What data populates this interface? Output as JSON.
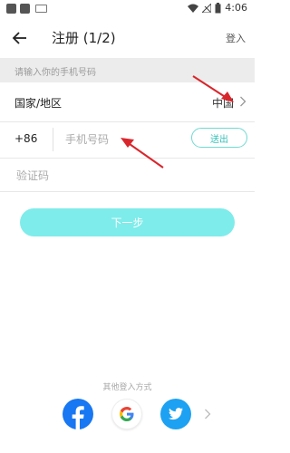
{
  "status_bar": {
    "time": "4:06"
  },
  "header": {
    "title": "注册 (1/2)",
    "login_link": "登入"
  },
  "hint": "请输入你的手机号码",
  "country_row": {
    "label": "国家/地区",
    "value": "中国"
  },
  "phone_row": {
    "code": "+86",
    "placeholder": "手机号码",
    "send_button": "送出"
  },
  "code_row": {
    "placeholder": "验证码"
  },
  "next_button": "下一步",
  "other_login": {
    "label": "其他登入方式",
    "providers": [
      "facebook-icon",
      "google-icon",
      "twitter-icon"
    ]
  },
  "colors": {
    "accent": "#7eecea",
    "annotation_arrow": "#d9262c",
    "facebook": "#1877f2",
    "twitter": "#1da1f2"
  }
}
